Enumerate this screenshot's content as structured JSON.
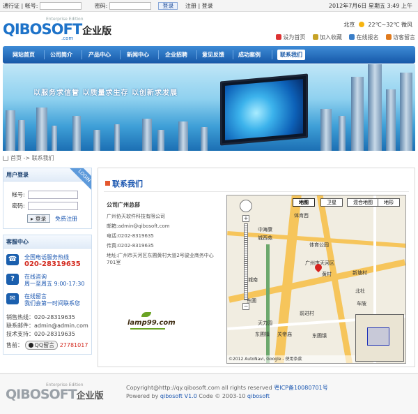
{
  "topbar": {
    "passport_label": "通行证",
    "account_label": "帐号:",
    "password_label": "密码:",
    "login_button": "登录",
    "register_link": "注册",
    "login_link": "登录",
    "datetime": "2012年7月6日 星期五 3:49 上午"
  },
  "header": {
    "logo_main": "QIBOSOFT",
    "logo_suffix": "企业版",
    "logo_edition": "Enterprise Edition",
    "logo_domain": ".com",
    "weather_city": "北京",
    "weather_temp": "22℃~32℃ 微风",
    "quick_links": [
      "设为首页",
      "加入收藏",
      "在线报名",
      "访客留言"
    ]
  },
  "nav": {
    "items": [
      "网站首页",
      "公司简介",
      "产品中心",
      "新闻中心",
      "企业招聘",
      "意见反馈",
      "成功案例",
      "联系我们"
    ],
    "active_index": 7
  },
  "banner": {
    "slogan": "以服务求信誉  以质量求生存  以创新求发展"
  },
  "breadcrumb": {
    "home": "首页",
    "separator": "->",
    "current": "联系我们"
  },
  "login_panel": {
    "title": "用户登录",
    "tag": "LOGIN",
    "account_label": "帐号:",
    "password_label": "密码:",
    "login_button": "登录",
    "register_link": "免费注册"
  },
  "service_panel": {
    "title": "客服中心",
    "items": [
      {
        "icon": "phone-icon",
        "title": "全国电话服务热线",
        "value": "020-28319635"
      },
      {
        "icon": "question-icon",
        "title": "在线咨询",
        "value": "周一至周五 9:00-17:30"
      },
      {
        "icon": "envelope-icon",
        "title": "在线留言",
        "value": "我们会第一时间联系您"
      }
    ],
    "lines": [
      "销售热线：020-28319635",
      "联系邮件：admin@admin.com",
      "技术支持：020-28319635"
    ],
    "qq_prefix": "售前：",
    "qq_label": "QQ留言",
    "qq_number": "27781017"
  },
  "content": {
    "title": "联系我们",
    "company_heading": "公司广州总部",
    "company_lines": [
      "广州协天软件科技有限公司",
      "邮箱:admin@qibosoft.com",
      "电话:0202-8319635",
      "传真:0202-8319635",
      "地址:广州市天河区东圃黄村大道2号骏业商务中心",
      "701室"
    ],
    "partner_logo": "lamp99.com"
  },
  "map": {
    "types": [
      "地图",
      "卫星",
      "混合地图",
      "地形"
    ],
    "active_type": 0,
    "labels": [
      "中海康",
      "城西苑",
      "体育公园",
      "东圃",
      "黄村",
      "北社",
      "车陂",
      "前进村",
      "东圃镇",
      "天力园",
      "关帝庙",
      "东圃镇",
      "广州市天河区",
      "体育西",
      "城南",
      "新塘村"
    ],
    "copyright": "©2012 AutoNavi, Google - 使用条款"
  },
  "footer": {
    "logo_main": "QIBOSOFT",
    "logo_suffix": "企业版",
    "logo_edition": "Enterprise Edition",
    "copyright_line": "Copyright@http://qy.qibosoft.com all rights reserved",
    "icp": "粤ICP备10080701号",
    "powered_prefix": "Powered by",
    "powered_link": "qibosoft V1.0",
    "code_text": "Code © 2003-10",
    "code_link": "qibosoft"
  },
  "colors": {
    "nav_blue": "#1658a8",
    "link_blue": "#1a56b0",
    "hotline_red": "#d32a1f"
  }
}
